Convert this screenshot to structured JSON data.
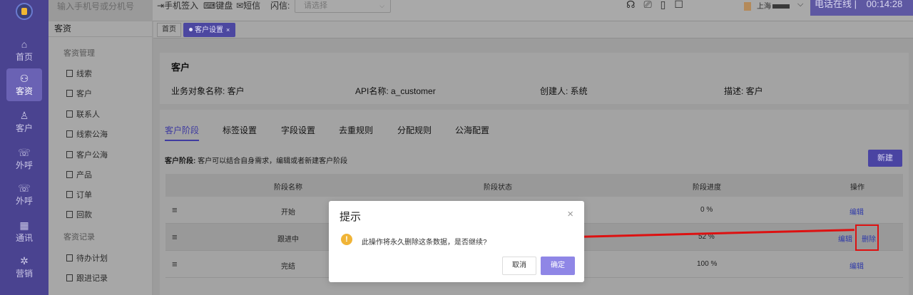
{
  "rail": {
    "items": [
      {
        "icon": "home-icon",
        "glyph": "⌂",
        "label": "首页"
      },
      {
        "icon": "users-icon",
        "glyph": "⚇",
        "label": "客资"
      },
      {
        "icon": "customer-icon",
        "glyph": "♙",
        "label": "客户"
      },
      {
        "icon": "phone-out-icon",
        "glyph": "☏",
        "label": "外呼"
      },
      {
        "icon": "phone-out-icon",
        "glyph": "☏",
        "label": "外呼"
      },
      {
        "icon": "contacts-icon",
        "glyph": "▦",
        "label": "通讯"
      },
      {
        "icon": "marketing-icon",
        "glyph": "✲",
        "label": "营销"
      }
    ]
  },
  "topbar": {
    "search_placeholder": "输入手机号或分机号",
    "phone_signin": "手机签入",
    "keyboard": "键盘",
    "sms": "短信",
    "flash_label": "闪信:",
    "flash_placeholder": "请选择",
    "user_region": "上海",
    "status": "电话在线 |",
    "timer": "00:14:28"
  },
  "subsidebar": {
    "header": "客资",
    "group1": "客资管理",
    "items1": [
      "线索",
      "客户",
      "联系人",
      "线索公海",
      "客户公海",
      "产品",
      "订单",
      "回款"
    ],
    "group2": "客资记录",
    "items2": [
      "待办计划",
      "跟进记录"
    ]
  },
  "breadcrumb": {
    "home": "首页",
    "active_tab": "客户设置",
    "close": "×"
  },
  "object_card": {
    "title": "客户",
    "business_name": "业务对象名称: 客户",
    "api_name": "API名称: a_customer",
    "creator": "创建人: 系统",
    "description": "描述: 客户"
  },
  "tabs": [
    "客户阶段",
    "标签设置",
    "字段设置",
    "去重规则",
    "分配规则",
    "公海配置"
  ],
  "stage_section": {
    "desc_label": "客户阶段:",
    "desc_text": "客户可以结合自身需求，编辑或者新建客户阶段",
    "new_button": "新建"
  },
  "table": {
    "headers": [
      "阶段名称",
      "阶段状态",
      "阶段进度",
      "操作"
    ],
    "rows": [
      {
        "name": "开始",
        "progress": "0 %",
        "actions": [
          "编辑"
        ]
      },
      {
        "name": "跟进中",
        "progress": "52 %",
        "actions": [
          "编辑",
          "删除"
        ]
      },
      {
        "name": "完结",
        "progress": "100 %",
        "actions": [
          "编辑"
        ]
      }
    ]
  },
  "modal": {
    "title": "提示",
    "close": "×",
    "message": "此操作将永久删除这条数据，是否继续?",
    "cancel": "取消",
    "confirm": "确定"
  },
  "colors": {
    "primary": "#4a44a2",
    "confirm": "#8f86e6",
    "warning": "#f0b437",
    "annotation": "#dd1111"
  }
}
